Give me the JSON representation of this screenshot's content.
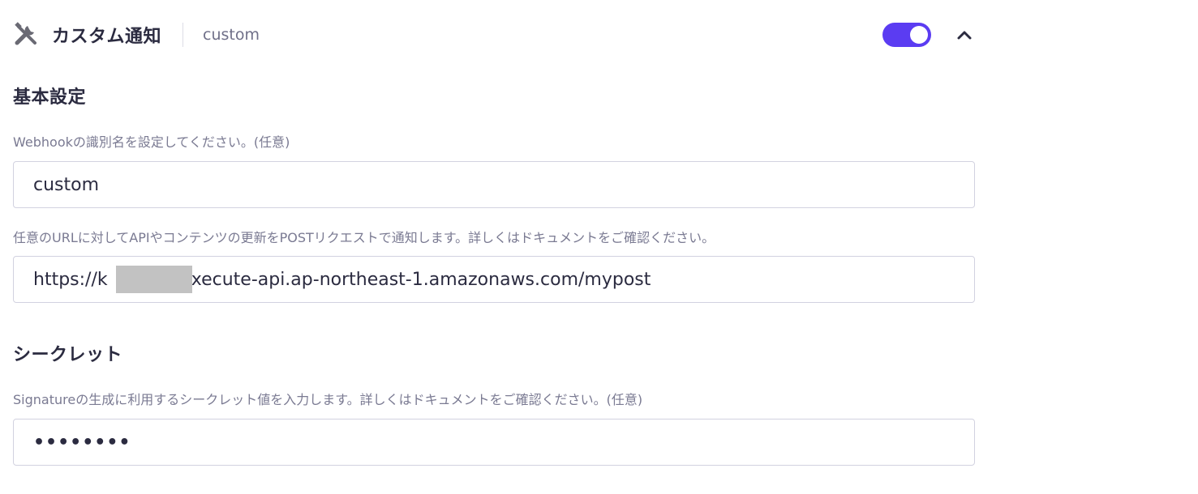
{
  "header": {
    "title": "カスタム通知",
    "subtitle": "custom",
    "toggle_on": true,
    "icon": "tools-icon",
    "collapse_icon": "chevron-up-icon"
  },
  "basic_settings": {
    "title": "基本設定",
    "name_label": "Webhookの識別名を設定してください。(任意)",
    "name_value": "custom",
    "url_label": "任意のURLに対してAPIやコンテンツの更新をPOSTリクエストで通知します。詳しくはドキュメントをご確認ください。",
    "url_value": "https://k         ui.execute-api.ap-northeast-1.amazonaws.com/mypost"
  },
  "secret": {
    "title": "シークレット",
    "label": "Signatureの生成に利用するシークレット値を入力します。詳しくはドキュメントをご確認ください。(任意)",
    "value": "••••••••"
  },
  "colors": {
    "accent": "#5b3cf2",
    "text": "#2b2b40",
    "muted": "#7a7a92",
    "border": "#d2d2e0",
    "redaction": "#c2c2c2"
  }
}
